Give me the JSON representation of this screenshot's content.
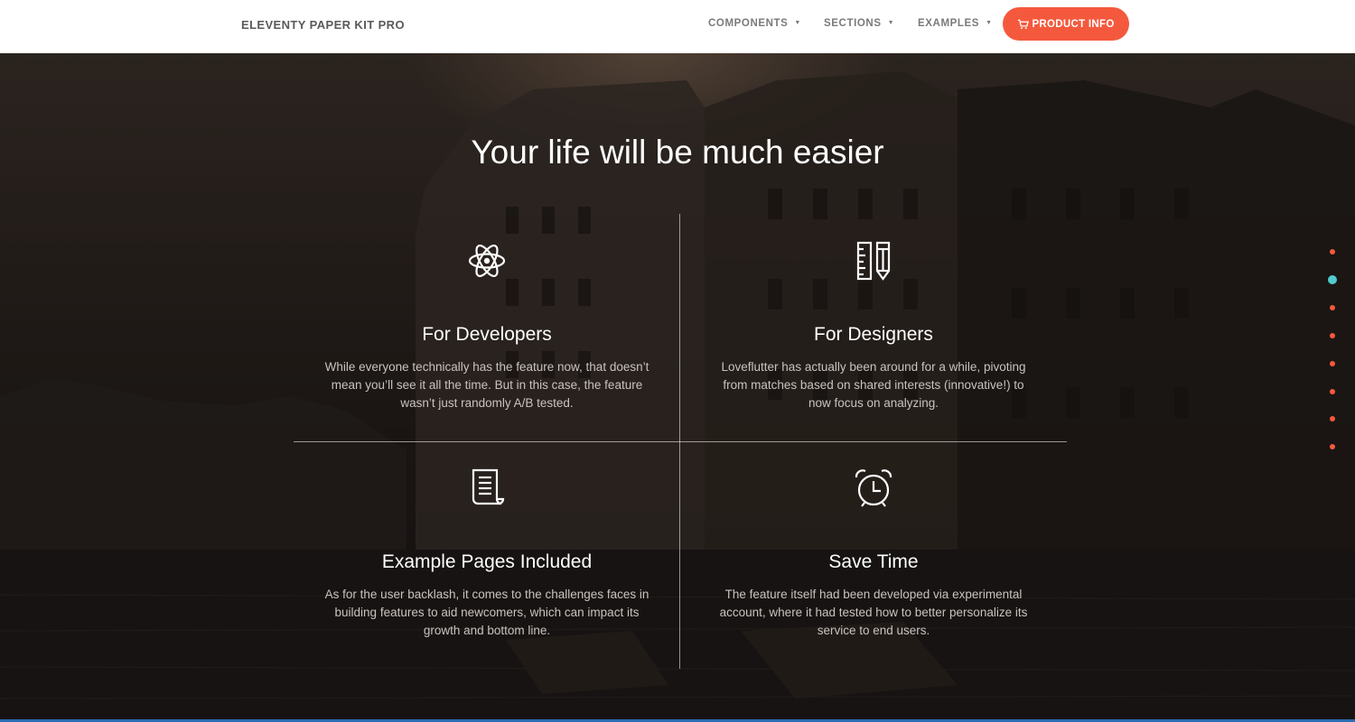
{
  "navbar": {
    "brand": "ELEVENTY PAPER KIT PRO",
    "items": [
      {
        "label": "COMPONENTS"
      },
      {
        "label": "SECTIONS"
      },
      {
        "label": "EXAMPLES"
      }
    ],
    "cta_label": "PRODUCT INFO",
    "cta_icon": "shopping-cart-icon",
    "cta_color": "#f5593d"
  },
  "hero": {
    "title": "Your life will be much easier",
    "features": [
      {
        "icon": "atom-icon",
        "title": "For Developers",
        "text": "While everyone technically has the feature now, that doesn’t mean you’ll see it all the time. But in this case, the feature wasn’t just randomly A/B tested."
      },
      {
        "icon": "ruler-pencil-icon",
        "title": "For Designers",
        "text": "Loveflutter has actually been around for a while, pivoting from matches based on shared interests (innovative!) to now focus on analyzing."
      },
      {
        "icon": "paper-scroll-icon",
        "title": "Example Pages Included",
        "text": "As for the user backlash, it comes to the challenges faces in building features to aid newcomers, which can impact its growth and bottom line."
      },
      {
        "icon": "alarm-clock-icon",
        "title": "Save Time",
        "text": "The feature itself had been developed via experimental account, where it had tested how to better personalize its service to end users."
      }
    ]
  },
  "section_nav": {
    "dot_count": 8,
    "active_index": 1,
    "dot_color": "#f5593d",
    "active_color": "#51cbce"
  }
}
